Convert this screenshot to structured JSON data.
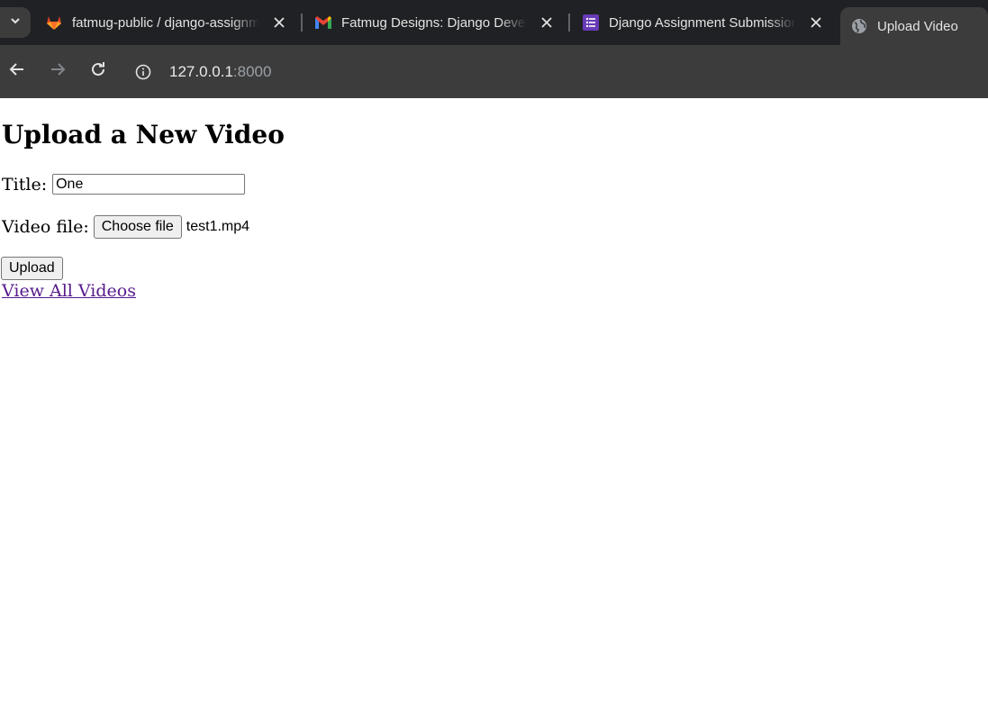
{
  "browser": {
    "tabs": [
      {
        "title": "fatmug-public / django-assignm",
        "favicon": "gitlab-icon"
      },
      {
        "title": "Fatmug Designs: Django Develo",
        "favicon": "gmail-icon"
      },
      {
        "title": "Django Assignment Submission",
        "favicon": "forms-icon"
      },
      {
        "title": "Upload Video",
        "favicon": "globe-icon",
        "active": true
      }
    ],
    "address": {
      "host": "127.0.0.1",
      "port": ":8000"
    }
  },
  "page": {
    "heading": "Upload a New Video",
    "title_label": "Title:",
    "title_value": "One",
    "file_label": "Video file:",
    "choose_file_label": "Choose file",
    "file_name": "test1.mp4",
    "upload_label": "Upload",
    "view_all_link": "View All Videos"
  },
  "colors": {
    "tabbar_bg": "#202124",
    "toolbar_bg": "#3c3c3c",
    "visited_link": "#551a8b"
  }
}
